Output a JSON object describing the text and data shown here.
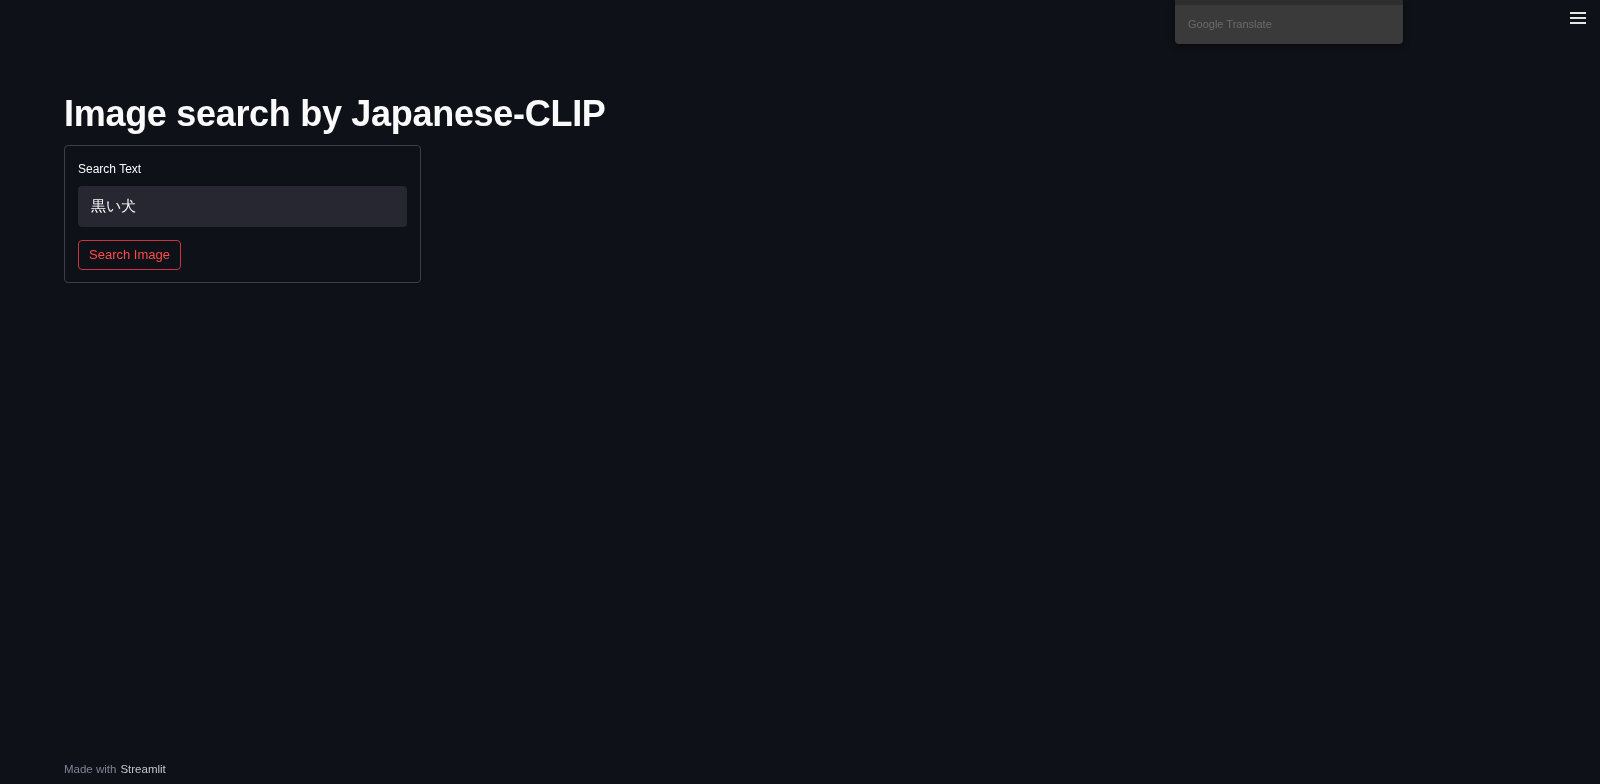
{
  "translate_popup": {
    "label": "Google Translate"
  },
  "title": "Image search by Japanese-CLIP",
  "form": {
    "label": "Search Text",
    "value": "黒い犬",
    "button": "Search Image"
  },
  "footer": {
    "prefix": "Made with",
    "link": "Streamlit"
  }
}
